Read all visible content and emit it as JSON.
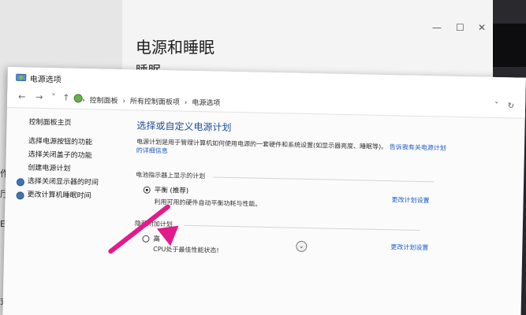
{
  "background": {
    "title": "电源和睡眠",
    "subtitle": "睡眠",
    "left_fragments": [
      "作",
      "厅",
      "E",
      "式"
    ]
  },
  "window": {
    "title": "电源选项"
  },
  "toolbar": {
    "back": "←",
    "forward": "→",
    "dropdown": "˅",
    "up": "↑",
    "breadcrumbs": [
      "控制面板",
      "所有控制面板项",
      "电源选项"
    ],
    "separator": "›",
    "refresh": "↻"
  },
  "sidebar": {
    "home": "控制面板主页",
    "items": [
      "选择电源按钮的功能",
      "选择关闭盖子的功能",
      "创建电源计划",
      "选择关闭显示器的时间",
      "更改计算机睡眠时间"
    ]
  },
  "main": {
    "title": "选择或自定义电源计划",
    "description": "电源计划是用于管理计算机如何使用电源的一套硬件和系统设置(如显示器亮度、睡眠等)。",
    "description_link": "告诉我有关电源计划",
    "description_link2": "的详细信息",
    "battery_group_label": "电池指示器上显示的计划",
    "hidden_group_label": "隐藏附加计划",
    "plans": [
      {
        "name": "平衡 (推荐)",
        "description": "利用可用的硬件自动平衡功耗与性能。",
        "change_link": "更改计划设置",
        "selected": true
      },
      {
        "name": "高",
        "description": "CPU处于最佳性能状态!",
        "change_link": "更改计划设置",
        "selected": false
      }
    ]
  },
  "colors": {
    "accent_title": "#1c4f9c",
    "link": "#1c5cc4",
    "annotation_arrow": "#e51a8a"
  }
}
